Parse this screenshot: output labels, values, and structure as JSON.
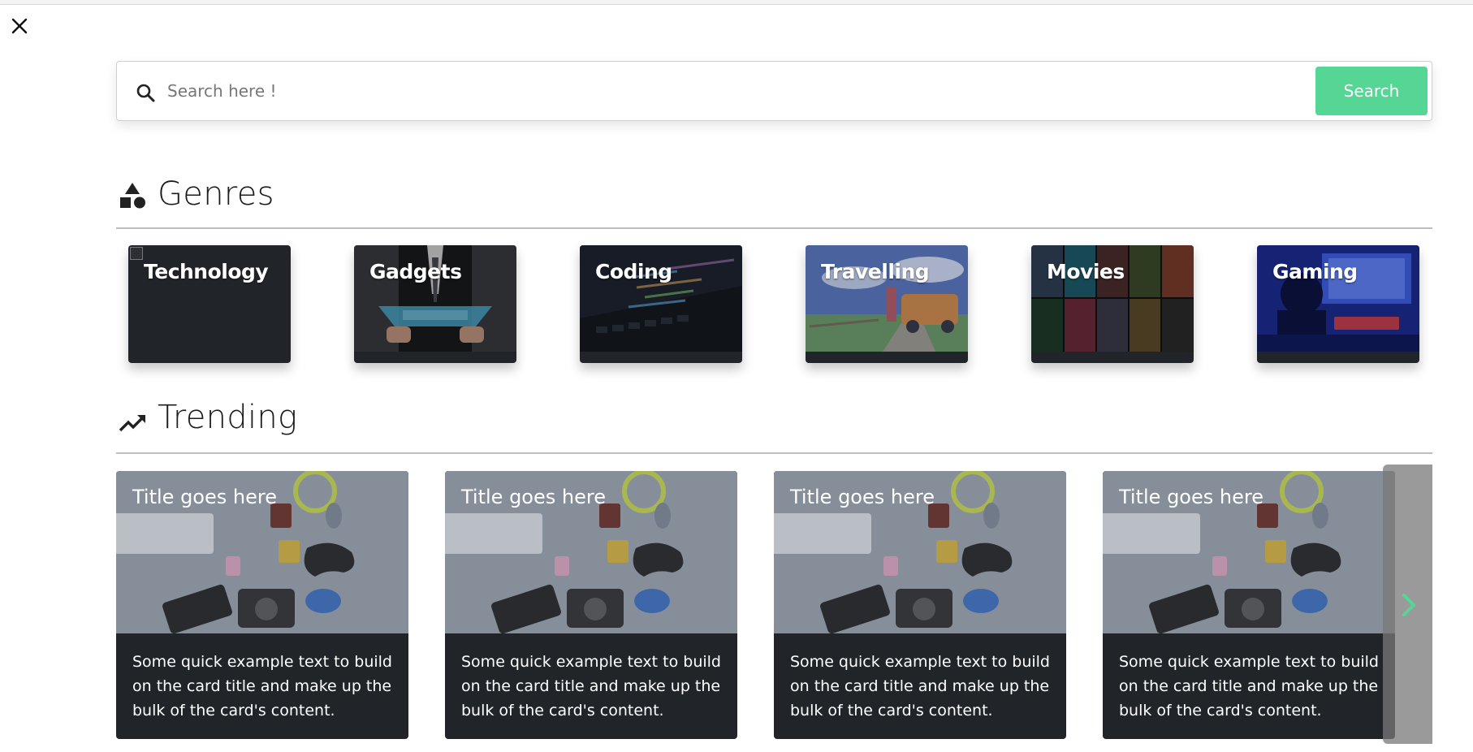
{
  "search": {
    "placeholder": "Search here !",
    "button_label": "Search"
  },
  "genres": {
    "heading": "Genres",
    "items": [
      {
        "label": "Technology"
      },
      {
        "label": "Gadgets"
      },
      {
        "label": "Coding"
      },
      {
        "label": "Travelling"
      },
      {
        "label": "Movies"
      },
      {
        "label": "Gaming"
      }
    ]
  },
  "trending": {
    "heading": "Trending",
    "cards": [
      {
        "title": "Title goes here",
        "text": "Some quick example text to build on the card title and make up the bulk of the card's content."
      },
      {
        "title": "Title goes here",
        "text": "Some quick example text to build on the card title and make up the bulk of the card's content."
      },
      {
        "title": "Title goes here",
        "text": "Some quick example text to build on the card title and make up the bulk of the card's content."
      },
      {
        "title": "Title goes here",
        "text": "Some quick example text to build on the card title and make up the bulk of the card's content."
      }
    ]
  },
  "icons": {
    "close": "close-icon",
    "search": "search-icon",
    "genres": "shapes-icon",
    "trending": "trending-up-icon",
    "next": "chevron-right-icon"
  },
  "colors": {
    "accent": "#55d694",
    "card_bg": "#212529",
    "heading_rule": "#bdbdbd"
  }
}
